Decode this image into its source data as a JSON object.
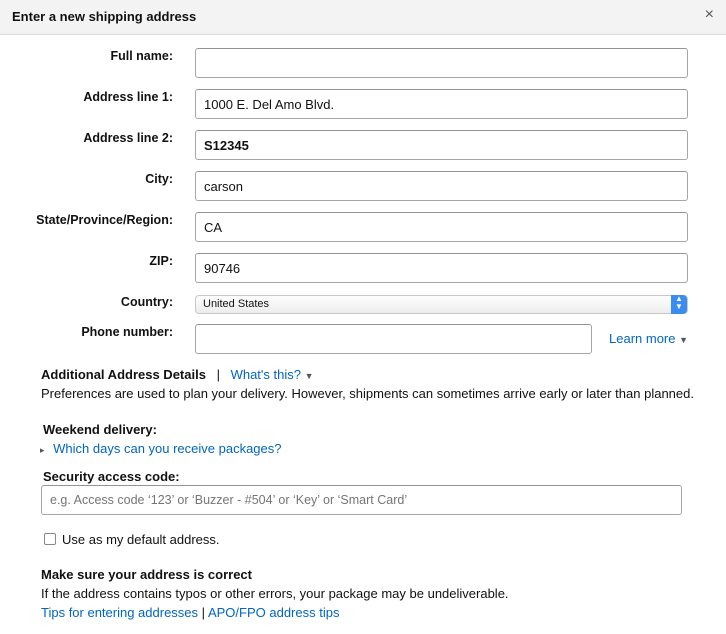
{
  "header": {
    "title": "Enter a new shipping address",
    "close": "×"
  },
  "form": {
    "full_name": {
      "label": "Full name:",
      "value": ""
    },
    "address1": {
      "label": "Address line 1:",
      "value": "1000 E. Del Amo Blvd."
    },
    "address2": {
      "label": "Address line 2:",
      "value": "S12345"
    },
    "city": {
      "label": "City:",
      "value": "carson"
    },
    "state": {
      "label": "State/Province/Region:",
      "value": "CA"
    },
    "zip": {
      "label": "ZIP:",
      "value": "90746"
    },
    "country": {
      "label": "Country:",
      "value": "United States",
      "arrow_up": "▲",
      "arrow_down": "▼"
    },
    "phone": {
      "label": "Phone number:",
      "value": "",
      "learn_more": "Learn more",
      "caret": "▼"
    }
  },
  "additional": {
    "title": "Additional Address Details",
    "separator": "|",
    "whats_this": "What's this?",
    "caret": "▼",
    "description": "Preferences are used to plan your delivery. However, shipments can sometimes arrive early or later than planned.",
    "weekend_title": "Weekend delivery:",
    "weekend_toggle": "▸",
    "weekend_link": "Which days can you receive packages?",
    "security_title": "Security access code:",
    "security_placeholder": "e.g. Access code ‘123’ or ‘Buzzer - #504’ or ‘Key’ or ‘Smart Card’"
  },
  "default_address": {
    "label": "Use as my default address.",
    "checked": false
  },
  "notice": {
    "title": "Make sure your address is correct",
    "text": "If the address contains typos or other errors, your package may be undeliverable.",
    "tips_link": "Tips for entering addresses",
    "separator": "|",
    "apo_link": "APO/FPO address tips"
  }
}
